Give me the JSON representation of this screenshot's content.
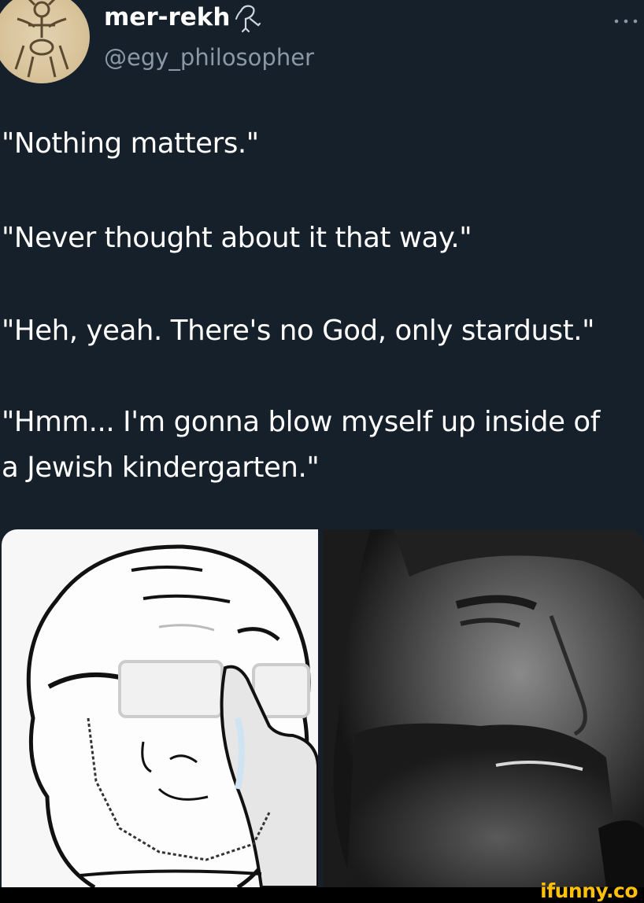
{
  "tweet": {
    "author": {
      "display_name": "mer-rekh",
      "handle": "@egy_philosopher",
      "name_badge_icon": "ibis-icon"
    },
    "more_icon": "more-horizontal-icon",
    "lines": [
      "\"Nothing matters.\"",
      "\"Never thought about it that way.\"",
      "\"Heh, yeah. There's no God, only stardust.\"",
      "\"Hmm... I'm gonna blow myself up inside of",
      "a Jewish kindergarten.\""
    ]
  },
  "meme_image": {
    "left_panel": "crying-wojak-glasses",
    "right_panel": "smirking-bearded-man"
  },
  "watermark": {
    "text": "ifunny.co",
    "color": "#ffc107"
  },
  "colors": {
    "background": "#15202b",
    "handle_text": "#8b98a5",
    "text": "#ffffff"
  }
}
